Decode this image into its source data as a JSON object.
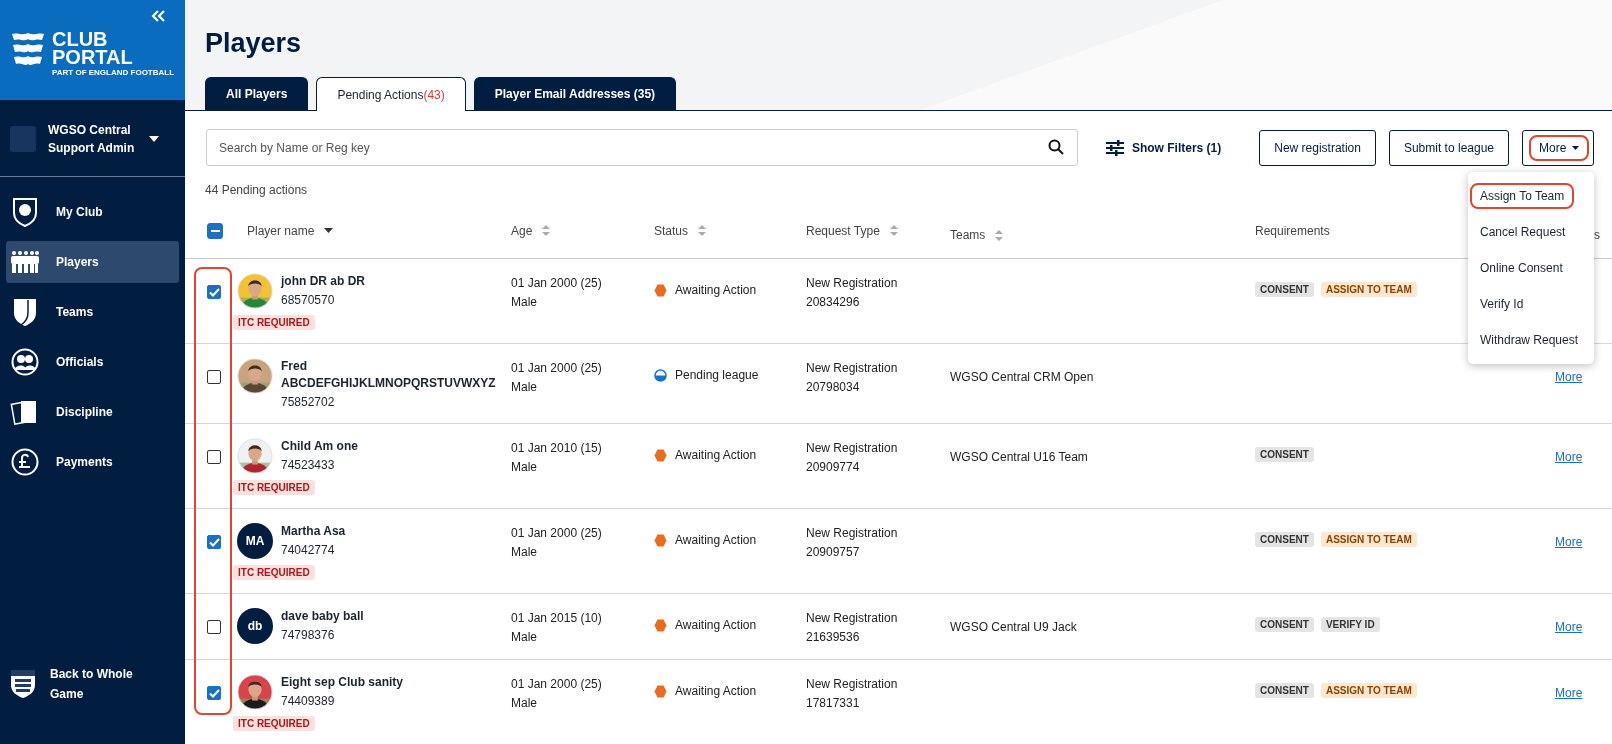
{
  "sidebar": {
    "logo": {
      "line1": "CLUB",
      "line2": "PORTAL",
      "tagline": "PART OF ENGLAND FOOTBALL"
    },
    "account": {
      "line1": "WGSO Central",
      "line2": "Support Admin"
    },
    "nav": [
      {
        "label": "My Club",
        "selected": false
      },
      {
        "label": "Players",
        "selected": true
      },
      {
        "label": "Teams",
        "selected": false
      },
      {
        "label": "Officials",
        "selected": false
      },
      {
        "label": "Discipline",
        "selected": false
      },
      {
        "label": "Payments",
        "selected": false
      }
    ],
    "footer_link": {
      "label": "Back to Whole Game"
    }
  },
  "page": {
    "title": "Players",
    "tabs": [
      {
        "label": "All Players",
        "selected": false
      },
      {
        "label": "Pending Actions",
        "count": "(43)",
        "selected": true
      },
      {
        "label": "Player Email Addresses (35)",
        "selected": false
      }
    ],
    "search": {
      "placeholder": "Search by Name or Reg key"
    },
    "filters": "Show Filters (1)",
    "buttons": [
      {
        "label": "New registration"
      },
      {
        "label": "Submit to league"
      }
    ],
    "more_button": {
      "label": "More",
      "highlighted": true
    },
    "menu": [
      {
        "label": "Assign To Team",
        "highlighted": true
      },
      {
        "label": "Cancel Request",
        "highlighted": false
      },
      {
        "label": "Online Consent",
        "highlighted": false
      },
      {
        "label": "Verify Id",
        "highlighted": false
      },
      {
        "label": "Withdraw Request",
        "highlighted": false
      }
    ],
    "summary": "44 Pending actions"
  },
  "table": {
    "select_all": {
      "indeterminate": true
    },
    "checkbox_column_highlighted": true,
    "columns": [
      {
        "label": "Player name",
        "sortable": true,
        "sorted": true
      },
      {
        "label": "Age",
        "sortable": true,
        "sorted": false
      },
      {
        "label": "Status",
        "sortable": true,
        "sorted": false
      },
      {
        "label": "Request Type",
        "sortable": true,
        "sorted": false
      },
      {
        "label": "Teams",
        "sortable": true,
        "sorted": false
      },
      {
        "label": "Requirements",
        "sortable": false
      },
      {
        "label": "s",
        "sortable": false
      }
    ],
    "rows": [
      {
        "checked": true,
        "avatar": {
          "kind": "picture"
        },
        "name": "john DR ab DR",
        "reg": "68570570",
        "itc": "ITC REQUIRED",
        "dob": "01 Jan 2000 (25)",
        "gender": "Male",
        "status": {
          "kind": "awaiting",
          "label": "Awaiting Action"
        },
        "request_type": "New Registration",
        "request_id": "20834296",
        "tags": [
          {
            "label": "CONSENT",
            "kind": "neutral"
          },
          {
            "label": "ASSIGN TO TEAM",
            "kind": "warning"
          }
        ]
      },
      {
        "checked": false,
        "avatar": {
          "kind": "picture"
        },
        "name": "Fred ABCDEFGHIJKLMNOPQRSTUVWXYZ",
        "reg": "75852702",
        "dob": "01 Jan 2000 (25)",
        "gender": "Male",
        "status": {
          "kind": "pending",
          "label": "Pending league"
        },
        "request_type": "New Registration",
        "request_id": "20798034",
        "team": "WGSO Central CRM Open",
        "more": "More"
      },
      {
        "checked": false,
        "avatar": {
          "kind": "picture"
        },
        "name": "Child Am one",
        "reg": "74523433",
        "itc": "ITC REQUIRED",
        "dob": "01 Jan 2010 (15)",
        "gender": "Male",
        "status": {
          "kind": "awaiting",
          "label": "Awaiting Action"
        },
        "request_type": "New Registration",
        "request_id": "20909774",
        "team": "WGSO Central U16 Team",
        "tags": [
          {
            "label": "CONSENT",
            "kind": "neutral"
          }
        ],
        "more": "More"
      },
      {
        "checked": true,
        "avatar": {
          "kind": "initials",
          "text": "MA"
        },
        "name": "Martha Asa",
        "reg": "74042774",
        "itc": "ITC REQUIRED",
        "dob": "01 Jan 2000 (25)",
        "gender": "Male",
        "status": {
          "kind": "awaiting",
          "label": "Awaiting Action"
        },
        "request_type": "New Registration",
        "request_id": "20909757",
        "tags": [
          {
            "label": "CONSENT",
            "kind": "neutral"
          },
          {
            "label": "ASSIGN TO TEAM",
            "kind": "warning"
          }
        ],
        "more": "More"
      },
      {
        "checked": false,
        "avatar": {
          "kind": "initials",
          "text": "db"
        },
        "name": "dave baby ball",
        "reg": "74798376",
        "dob": "01 Jan 2015 (10)",
        "gender": "Male",
        "status": {
          "kind": "awaiting",
          "label": "Awaiting Action"
        },
        "request_type": "New Registration",
        "request_id": "21639536",
        "team": "WGSO Central U9 Jack",
        "tags": [
          {
            "label": "CONSENT",
            "kind": "neutral"
          },
          {
            "label": "VERIFY ID",
            "kind": "neutral"
          }
        ],
        "more": "More"
      },
      {
        "checked": true,
        "avatar": {
          "kind": "picture"
        },
        "name": "Eight sep Club sanity",
        "reg": "74409389",
        "itc": "ITC REQUIRED",
        "dob": "01 Jan 2000 (25)",
        "gender": "Male",
        "status": {
          "kind": "awaiting",
          "label": "Awaiting Action"
        },
        "request_type": "New Registration",
        "request_id": "17817331",
        "tags": [
          {
            "label": "CONSENT",
            "kind": "neutral"
          },
          {
            "label": "ASSIGN TO TEAM",
            "kind": "warning"
          }
        ],
        "more": "More"
      }
    ]
  }
}
